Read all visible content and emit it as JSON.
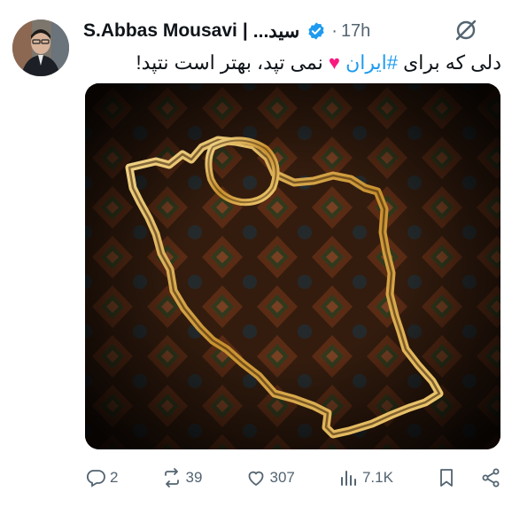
{
  "author": {
    "name": "S.Abbas Mousavi",
    "separator": "|",
    "handle_fragment": "...سید",
    "verified_color": "#1d9bf0"
  },
  "meta": {
    "dot": "·",
    "time": "17h"
  },
  "tweet": {
    "text_before": "دلی که برای ",
    "hashtag": "#ایران",
    "heart": "♥",
    "text_after": " نمی تپد، بهتر است نتپد!"
  },
  "actions": {
    "replies": "2",
    "reposts": "39",
    "likes": "307",
    "views": "7.1K"
  },
  "colors": {
    "accent": "#1d9bf0",
    "heart": "#f91880",
    "muted": "#536471",
    "gold": "#d9a441"
  },
  "icons": [
    "grok-icon",
    "verified-icon",
    "reply-icon",
    "repost-icon",
    "like-icon",
    "views-icon",
    "bookmark-icon",
    "share-icon"
  ]
}
